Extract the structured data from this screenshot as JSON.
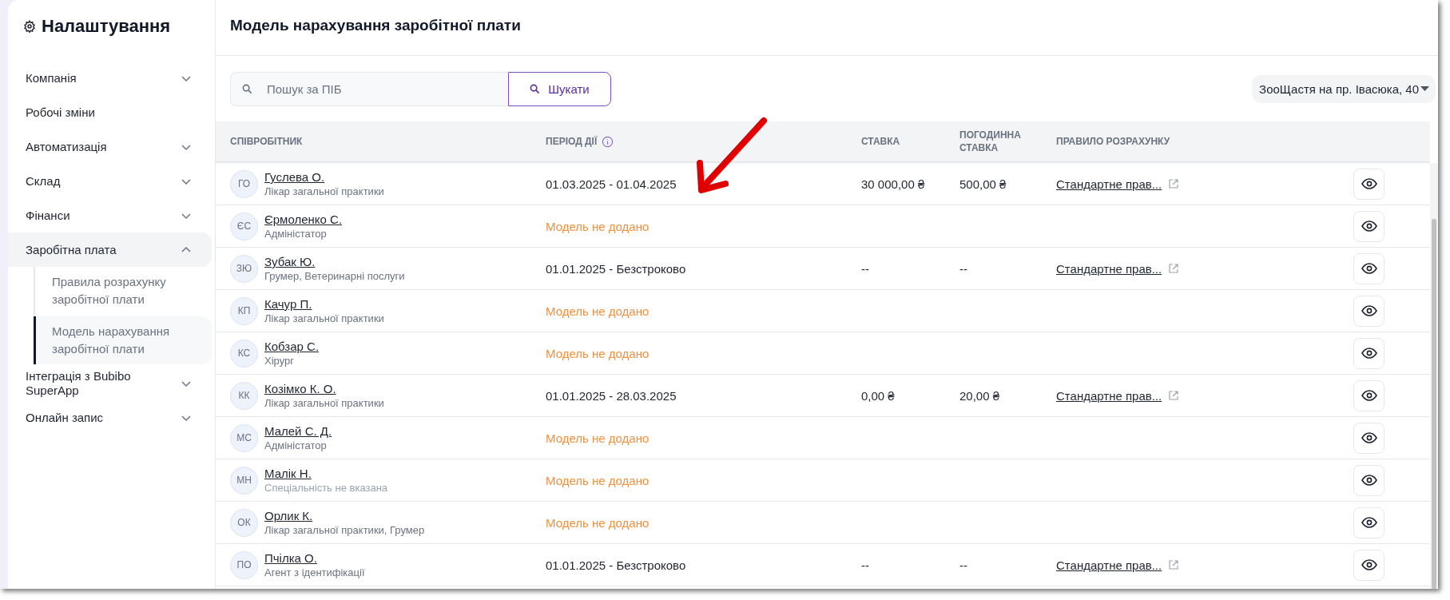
{
  "sidebar": {
    "title": "Налаштування",
    "items": [
      {
        "label": "Компанія",
        "expandable": true,
        "expanded": false
      },
      {
        "label": "Робочі зміни",
        "expandable": false,
        "expanded": false
      },
      {
        "label": "Автоматизація",
        "expandable": true,
        "expanded": false
      },
      {
        "label": "Склад",
        "expandable": true,
        "expanded": false
      },
      {
        "label": "Фінанси",
        "expandable": true,
        "expanded": false
      },
      {
        "label": "Заробітна плата",
        "expandable": true,
        "expanded": true,
        "children": [
          {
            "label": "Правила розрахунку заробітної плати",
            "selected": false
          },
          {
            "label": "Модель нарахування заробітної плати",
            "selected": true
          }
        ]
      },
      {
        "label": "Інтеграція з Bubibo SuperApp",
        "expandable": true,
        "expanded": false
      },
      {
        "label": "Онлайн запис",
        "expandable": true,
        "expanded": false
      }
    ]
  },
  "page": {
    "title": "Модель нарахування заробітної плати"
  },
  "search": {
    "placeholder": "Пошук за ПІБ",
    "button": "Шукати"
  },
  "location_select": {
    "value": "ЗооЩастя на пр. Івасюка, 40"
  },
  "table": {
    "columns": [
      {
        "label": "СПІВРОБІТНИК",
        "info": false
      },
      {
        "label": "ПЕРІОД ДІЇ",
        "info": true
      },
      {
        "label": "СТАВКА",
        "info": false
      },
      {
        "label": "ПОГОДИННА СТАВКА",
        "info": false
      },
      {
        "label": "ПРАВИЛО РОЗРАХУНКУ",
        "info": false
      }
    ],
    "rows": [
      {
        "initials": "ГО",
        "name": "Гуслева О.",
        "specialty": "Лікар загальної практики",
        "specialty_set": true,
        "period": "01.03.2025 - 01.04.2025",
        "model_added": true,
        "rate": "30 000,00 ₴",
        "hourly_rate": "500,00 ₴",
        "rule": "Стандартне прав..."
      },
      {
        "initials": "ЄС",
        "name": "Єрмоленко С.",
        "specialty": "Адміністатор",
        "specialty_set": true,
        "period": "Модель не додано",
        "model_added": false
      },
      {
        "initials": "ЗЮ",
        "name": "Зубак Ю.",
        "specialty": "Грумер, Ветеринарні послуги",
        "specialty_set": true,
        "period": "01.01.2025 - Безстроково",
        "model_added": true,
        "rate": "--",
        "hourly_rate": "--",
        "rule": "Стандартне прав..."
      },
      {
        "initials": "КП",
        "name": "Качур П.",
        "specialty": "Лікар загальної практики",
        "specialty_set": true,
        "period": "Модель не додано",
        "model_added": false
      },
      {
        "initials": "КС",
        "name": "Кобзар С.",
        "specialty": "Хірург",
        "specialty_set": true,
        "period": "Модель не додано",
        "model_added": false
      },
      {
        "initials": "КК",
        "name": "Козімко К. О.",
        "specialty": "Лікар загальної практики",
        "specialty_set": true,
        "period": "01.01.2025 - 28.03.2025",
        "model_added": true,
        "rate": "0,00 ₴",
        "hourly_rate": "20,00 ₴",
        "rule": "Стандартне прав..."
      },
      {
        "initials": "МС",
        "name": "Малей С. Д.",
        "specialty": "Адміністатор",
        "specialty_set": true,
        "period": "Модель не додано",
        "model_added": false
      },
      {
        "initials": "МН",
        "name": "Малік Н.",
        "specialty": "Спеціальність не вказана",
        "specialty_set": false,
        "period": "Модель не додано",
        "model_added": false
      },
      {
        "initials": "ОК",
        "name": "Орлик К.",
        "specialty": "Лікар загальної практики, Грумер",
        "specialty_set": true,
        "period": "Модель не додано",
        "model_added": false
      },
      {
        "initials": "ПО",
        "name": "Пчілка О.",
        "specialty": "Агент з ідентифікації",
        "specialty_set": true,
        "period": "01.01.2025 - Безстроково",
        "model_added": true,
        "rate": "--",
        "hourly_rate": "--",
        "rule": "Стандартне прав..."
      }
    ]
  }
}
